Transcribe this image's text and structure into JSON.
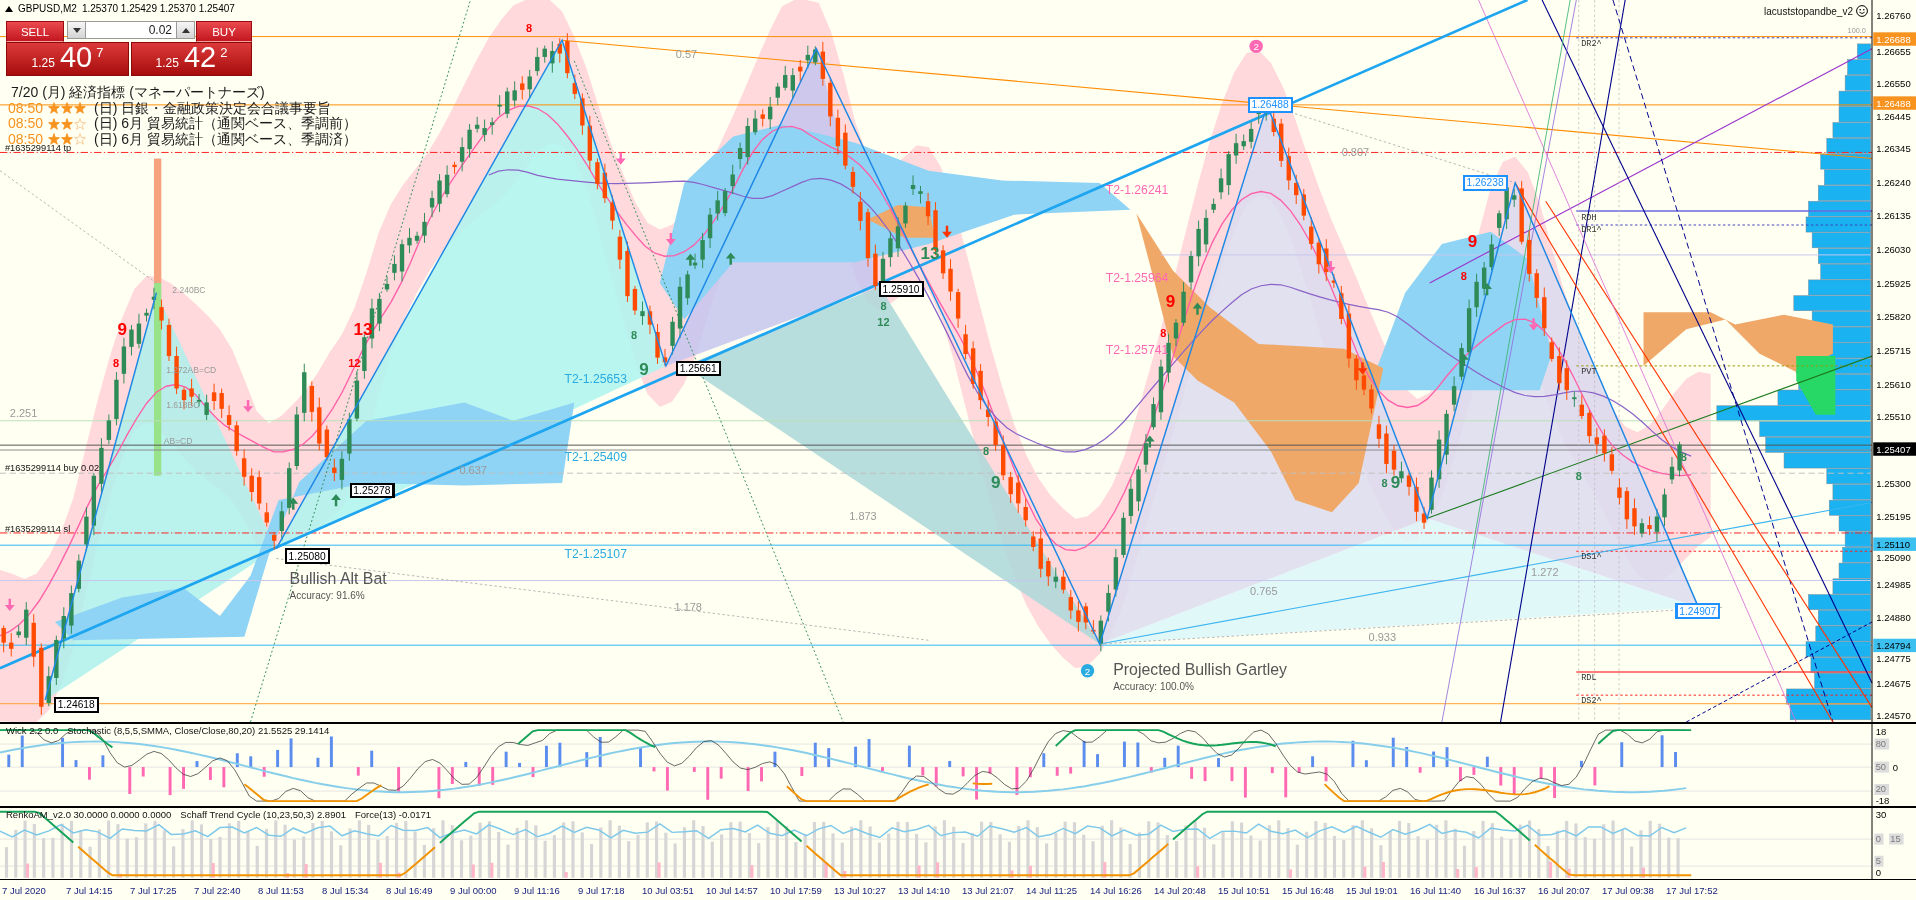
{
  "header": {
    "symbol": "GBPUSD,M2",
    "ohlc": "1.25370 1.25429 1.25370 1.25407"
  },
  "trade_panel": {
    "sell": {
      "label": "SELL",
      "price_head": "1.25",
      "price_pips": "40",
      "price_point": "7"
    },
    "lot": "0.02",
    "buy": {
      "label": "BUY",
      "price_head": "1.25",
      "price_pips": "42",
      "price_point": "2"
    }
  },
  "news": {
    "title": "7/20 (月) 経済指標 (マネーパートナーズ)",
    "items": [
      {
        "time": "08:50",
        "stars": 3,
        "text": "(日) 日銀・金融政策決定会合議事要旨"
      },
      {
        "time": "08:50",
        "stars": 2,
        "text": "(日) 6月 貿易統計（通関ベース、季調前）"
      },
      {
        "time": "08:50",
        "stars": 2,
        "text": "(日) 6月 貿易統計（通関ベース、季調済）"
      }
    ]
  },
  "chart": {
    "expert": "lacuststopandbe_v2",
    "order_labels": [
      "#1635299114 tp",
      "#1635299114 buy 0.02",
      "#1635299114 sl"
    ],
    "target_labels": [
      {
        "text": "T2-1.25653",
        "color": "#29abe2"
      },
      {
        "text": "T2-1.25409",
        "color": "#29abe2"
      },
      {
        "text": "T2-1.25107",
        "color": "#29abe2"
      },
      {
        "text": "T2-1.26241",
        "color": "#ff69b4"
      },
      {
        "text": "T2-1.25964",
        "color": "#ff69b4"
      },
      {
        "text": "T2-1.25741",
        "color": "#ff69b4"
      }
    ],
    "swing_labels": [
      {
        "text": "1.24618",
        "color": "#000000"
      },
      {
        "text": "1.25080",
        "color": "#000000"
      },
      {
        "text": "1.25278",
        "color": "#000000"
      },
      {
        "text": "1.25661",
        "color": "#000000"
      },
      {
        "text": "1.25910",
        "color": "#000000"
      },
      {
        "text": "1.26488",
        "color": "#1e90ff"
      },
      {
        "text": "1.26238",
        "color": "#1e90ff"
      },
      {
        "text": "1.24907",
        "color": "#1e90ff"
      }
    ],
    "ratio_labels": [
      "0.57",
      "0.807",
      "2.240BC",
      "1.272AB=CD",
      "1.618BC",
      "AB=CD",
      "2.251",
      "0.637",
      "1.873",
      "1.178",
      "0.765",
      "0.933",
      "1.272",
      "100.0"
    ],
    "counts": [
      {
        "text": "8",
        "kind": "step",
        "color": "#ff0000"
      },
      {
        "text": "9",
        "kind": "completion",
        "color": "#ff0000"
      },
      {
        "text": "8",
        "kind": "step",
        "color": "#ff0000"
      },
      {
        "text": "13",
        "kind": "completion",
        "color": "#ff0000"
      },
      {
        "text": "12",
        "kind": "step",
        "color": "#ff0000"
      },
      {
        "text": "9",
        "kind": "completion",
        "color": "#ff0000"
      },
      {
        "text": "8",
        "kind": "step",
        "color": "#ff0000"
      },
      {
        "text": "9",
        "kind": "completion",
        "color": "#ff0000"
      },
      {
        "text": "8",
        "kind": "step",
        "color": "#ff0000"
      },
      {
        "text": "8",
        "kind": "step",
        "color": "#2e8b57"
      },
      {
        "text": "9",
        "kind": "completion",
        "color": "#2e8b57"
      },
      {
        "text": "8",
        "kind": "step",
        "color": "#2e8b57"
      },
      {
        "text": "12",
        "kind": "step",
        "color": "#2e8b57"
      },
      {
        "text": "13",
        "kind": "completion",
        "color": "#2e8b57"
      },
      {
        "text": "8",
        "kind": "step",
        "color": "#2e8b57"
      },
      {
        "text": "9",
        "kind": "completion",
        "color": "#2e8b57"
      },
      {
        "text": "8",
        "kind": "step",
        "color": "#2e8b57"
      },
      {
        "text": "9",
        "kind": "completion",
        "color": "#2e8b57"
      },
      {
        "text": "8",
        "kind": "step",
        "color": "#2e8b57"
      },
      {
        "text": "8",
        "kind": "step",
        "color": "#2e8b57"
      }
    ],
    "arrows": [
      {
        "kind": "down",
        "color": "#ff69b4"
      },
      {
        "kind": "down",
        "color": "#ff69b4"
      },
      {
        "kind": "up",
        "color": "#2e8b57"
      },
      {
        "kind": "up",
        "color": "#2e8b57"
      },
      {
        "kind": "down",
        "color": "#ff69b4"
      },
      {
        "kind": "down",
        "color": "#ff69b4"
      },
      {
        "kind": "up",
        "color": "#2e8b57"
      },
      {
        "kind": "up",
        "color": "#2e8b57"
      },
      {
        "kind": "down",
        "color": "#ff3300"
      },
      {
        "kind": "up",
        "color": "#2e8b57"
      },
      {
        "kind": "up",
        "color": "#2e8b57"
      },
      {
        "kind": "down",
        "color": "#ff69b4"
      },
      {
        "kind": "down",
        "color": "#ff3300"
      },
      {
        "kind": "up",
        "color": "#2e8b57"
      },
      {
        "kind": "up",
        "color": "#2e8b57"
      },
      {
        "kind": "down",
        "color": "#ff69b4"
      }
    ],
    "badges": [
      {
        "text": "2",
        "color": "#ff69b4"
      },
      {
        "text": "2",
        "color": "#29abe2"
      }
    ],
    "patterns": [
      {
        "name": "Bullish Alt Bat",
        "accuracy": "Accuracy: 91.6%"
      },
      {
        "name": "Projected Bullish Gartley",
        "accuracy": "Accuracy: 100.0%"
      }
    ],
    "pivot_labels": [
      "DR2^",
      "RDH",
      "DR1^",
      "PVT",
      "DS1^",
      "RDL",
      "DS2^"
    ]
  },
  "price_axis": {
    "ticks": [
      "1.26760",
      "1.26655",
      "1.26550",
      "1.26445",
      "1.26345",
      "1.26240",
      "1.26135",
      "1.26030",
      "1.25925",
      "1.25820",
      "1.25715",
      "1.25610",
      "1.25510",
      "1.25300",
      "1.25195",
      "1.25090",
      "1.24985",
      "1.24880",
      "1.24775",
      "1.24675",
      "1.24570"
    ],
    "markers": [
      {
        "text": "1.26688",
        "color": "#f7931e"
      },
      {
        "text": "1.26488",
        "color": "#f7931e"
      },
      {
        "text": "1.25407",
        "color": "#000000"
      },
      {
        "text": "1.25110",
        "color": "#3cc0f0"
      },
      {
        "text": "1.24794",
        "color": "#3cc0f0"
      }
    ]
  },
  "stochastic_panel": {
    "labels": [
      "Wick 2.2 0.0",
      "Stochastic (8,5,5,SMMA, Close/Close,80,20) 21.5525 29.1414"
    ],
    "ticks": [
      {
        "text": "18",
        "kind": "value"
      },
      {
        "text": "80",
        "kind": "level"
      },
      {
        "text": "50",
        "kind": "level"
      },
      {
        "text": "0",
        "kind": "value"
      },
      {
        "text": "20",
        "kind": "level"
      },
      {
        "text": "-18",
        "kind": "value"
      }
    ]
  },
  "schaff_panel": {
    "labels": [
      "RenkoAM_v2.0 30.0000 0.0000 0.0000",
      "Schaff Trend Cycle (10,23,50,3) 2.8901",
      "Force(13) -0.0171"
    ],
    "ticks": [
      {
        "text": "30",
        "kind": "value"
      },
      {
        "text": "0",
        "kind": "level"
      },
      {
        "text": "15",
        "kind": "level"
      },
      {
        "text": "5",
        "kind": "level"
      },
      {
        "text": "0",
        "kind": "value"
      }
    ]
  },
  "time_axis": [
    "7 Jul 2020",
    "7 Jul 14:15",
    "7 Jul 17:25",
    "7 Jul 22:40",
    "8 Jul 11:53",
    "8 Jul 15:34",
    "8 Jul 16:49",
    "9 Jul 00:00",
    "9 Jul 11:16",
    "9 Jul 17:18",
    "10 Jul 03:51",
    "10 Jul 14:57",
    "10 Jul 17:59",
    "13 Jul 10:27",
    "13 Jul 14:10",
    "13 Jul 21:07",
    "14 Jul 11:25",
    "14 Jul 16:26",
    "14 Jul 20:48",
    "15 Jul 10:51",
    "15 Jul 16:48",
    "15 Jul 19:01",
    "16 Jul 11:40",
    "16 Jul 16:37",
    "16 Jul 20:07",
    "17 Jul 09:38",
    "17 Jul 17:52"
  ]
}
